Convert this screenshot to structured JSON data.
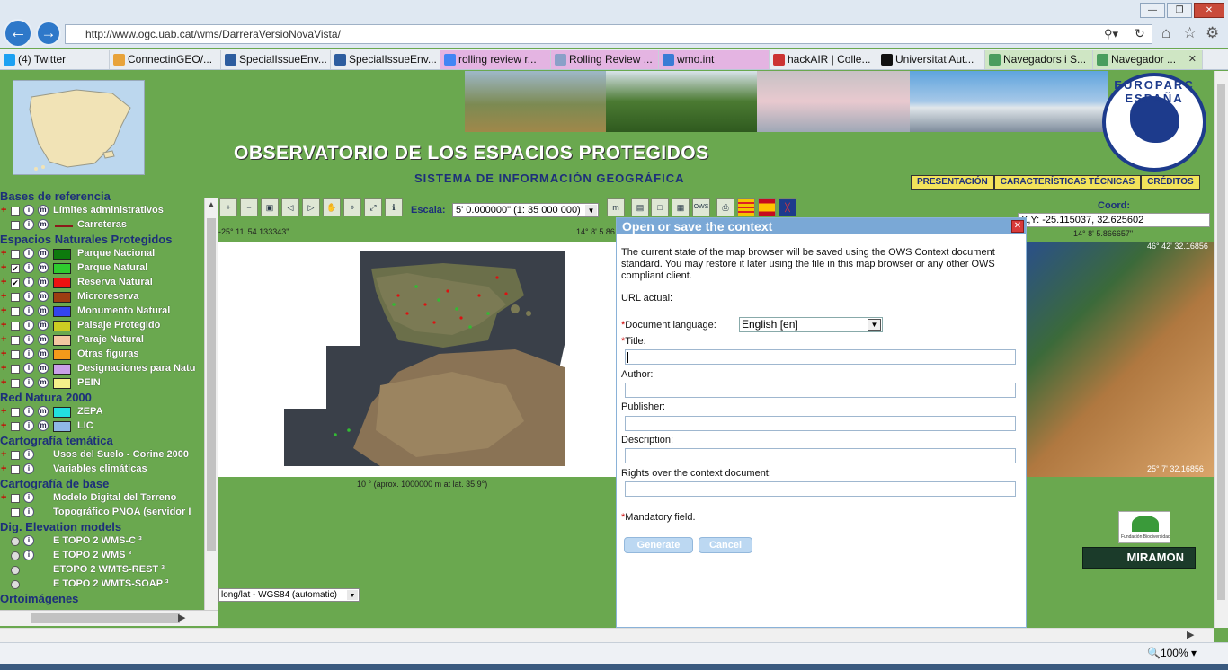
{
  "browser": {
    "url": "http://www.ogc.uab.cat/wms/DarreraVersioNovaVista/",
    "tabs": [
      {
        "label": "(4) Twitter",
        "color": "#1da1f2"
      },
      {
        "label": "ConnectinGEO/...",
        "color": "#e8a33b"
      },
      {
        "label": "SpecialIssueEnv...",
        "color": "#2d5d9f"
      },
      {
        "label": "SpecialIssueEnv...",
        "color": "#2d5d9f"
      },
      {
        "label": "rolling review r...",
        "color": "#4285f4"
      },
      {
        "label": "Rolling Review ...",
        "color": "#8aa0c8"
      },
      {
        "label": "wmo.int",
        "color": "#3a7bd5"
      },
      {
        "label": "hackAIR | Colle...",
        "color": "#c33"
      },
      {
        "label": "Universitat Aut...",
        "color": "#111"
      },
      {
        "label": "Navegadors i S...",
        "color": "#4a9d5e"
      },
      {
        "label": "Navegador ...",
        "color": "#4a9d5e"
      }
    ],
    "zoom": "100%"
  },
  "header": {
    "title": "OBSERVATORIO DE LOS ESPACIOS PROTEGIDOS",
    "subtitle": "SISTEMA DE INFORMACIÓN GEOGRÁFICA",
    "logo": "EUROPARC ESPAÑA",
    "nav": [
      "PRESENTACIÓN",
      "CARACTERÍSTICAS TÉCNICAS",
      "CRÉDITOS"
    ]
  },
  "toolbar": {
    "scale_label": "Escala:",
    "scale_value": "5' 0.000000\" (1: 35 000 000)",
    "coord_label": "Coord:",
    "coord_value": "X,Y: -25.115037, 32.625602"
  },
  "map": {
    "top_left_coord": "-25° 11' 54.133343\"",
    "top_mid_coord": "14° 8' 5.86",
    "top_right_coord": "14° 8' 5.866657\"",
    "right_top_lat": "46° 42' 32.16856",
    "right_bottom_lat": "25° 7' 32.16856",
    "scale_bar_text": "10 ° (aprox. 1000000 m at lat. 35.9°)",
    "crs": "long/lat - WGS84 (automatic)"
  },
  "sidebar": [
    {
      "type": "group",
      "label": "Bases de referencia"
    },
    {
      "type": "layer",
      "label": "Límites administrativos",
      "plus": true,
      "checked": false,
      "swatch": null
    },
    {
      "type": "layer",
      "label": "Carreteras",
      "plus": false,
      "checked": false,
      "swatch": "#8b1a1a"
    },
    {
      "type": "group",
      "label": "Espacios Naturales Protegidos"
    },
    {
      "type": "layer",
      "label": "Parque Nacional",
      "plus": true,
      "checked": false,
      "swatch": "#0d7a0d"
    },
    {
      "type": "layer",
      "label": "Parque Natural",
      "plus": true,
      "checked": true,
      "swatch": "#2ecc2e"
    },
    {
      "type": "layer",
      "label": "Reserva Natural",
      "plus": true,
      "checked": true,
      "swatch": "#ee1111"
    },
    {
      "type": "layer",
      "label": "Microreserva",
      "plus": true,
      "checked": false,
      "swatch": "#9c3e12"
    },
    {
      "type": "layer",
      "label": "Monumento Natural",
      "plus": true,
      "checked": false,
      "swatch": "#3344ee"
    },
    {
      "type": "layer",
      "label": "Paisaje Protegido",
      "plus": true,
      "checked": false,
      "swatch": "#cccc22"
    },
    {
      "type": "layer",
      "label": "Paraje Natural",
      "plus": true,
      "checked": false,
      "swatch": "#f3c7a0"
    },
    {
      "type": "layer",
      "label": "Otras figuras",
      "plus": true,
      "checked": false,
      "swatch": "#f39a1a"
    },
    {
      "type": "layer",
      "label": "Designaciones para Natu",
      "plus": true,
      "checked": false,
      "swatch": "#c9a0e8"
    },
    {
      "type": "layer",
      "label": "PEIN",
      "plus": true,
      "checked": false,
      "swatch": "#f4f08a"
    },
    {
      "type": "group",
      "label": "Red Natura 2000"
    },
    {
      "type": "layer",
      "label": "ZEPA",
      "plus": true,
      "checked": false,
      "swatch": "#22e0e0"
    },
    {
      "type": "layer",
      "label": "LIC",
      "plus": true,
      "checked": false,
      "swatch": "#8fb8e6"
    },
    {
      "type": "group",
      "label": "Cartografía temática"
    },
    {
      "type": "layer",
      "label": "Usos del Suelo - Corine 2000",
      "plus": true,
      "checked": false,
      "swatch": null
    },
    {
      "type": "layer",
      "label": "Variables climáticas",
      "plus": true,
      "checked": false,
      "swatch": null
    },
    {
      "type": "group",
      "label": "Cartografía de base"
    },
    {
      "type": "layer",
      "label": "Modelo Digital del Terreno",
      "plus": true,
      "checked": false,
      "swatch": null
    },
    {
      "type": "layer",
      "label": "Topográfico PNOA (servidor I",
      "plus": false,
      "checked": false,
      "swatch": null
    },
    {
      "type": "group",
      "label": "Dig. Elevation models"
    },
    {
      "type": "radio",
      "label": "E TOPO 2 WMS-C ³"
    },
    {
      "type": "radio",
      "label": "E TOPO 2 WMS ³"
    },
    {
      "type": "radio",
      "label": "ETOPO 2 WMTS-REST ³"
    },
    {
      "type": "radio",
      "label": "E TOPO 2 WMTS-SOAP ³"
    },
    {
      "type": "group",
      "label": "Ortoimágenes"
    }
  ],
  "dialog": {
    "title": "Open or save the context",
    "intro": "The current state of the map browser will be saved using the OWS Context document standard. You may restore it later using the file in this map browser or any other OWS compliant client.",
    "url_label": "URL actual:",
    "lang_label": "Document language:",
    "lang_value": "English [en]",
    "title_label": "Title:",
    "author_label": "Author:",
    "publisher_label": "Publisher:",
    "description_label": "Description:",
    "rights_label": "Rights over the context document:",
    "mandatory_note": "Mandatory field.",
    "asterisk": "*",
    "generate": "Generate",
    "cancel": "Cancel"
  },
  "sponsors": {
    "fb": "Fundación Biodiversidad",
    "miramon": "MIRAMON"
  }
}
